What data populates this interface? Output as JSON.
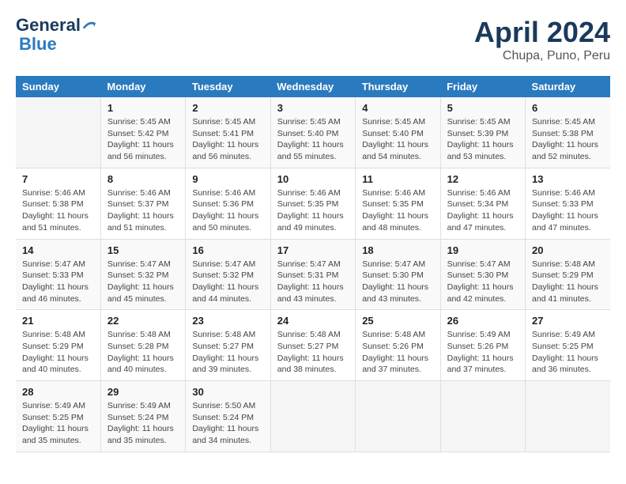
{
  "header": {
    "logo_line1": "General",
    "logo_line2": "Blue",
    "month": "April 2024",
    "location": "Chupa, Puno, Peru"
  },
  "weekdays": [
    "Sunday",
    "Monday",
    "Tuesday",
    "Wednesday",
    "Thursday",
    "Friday",
    "Saturday"
  ],
  "weeks": [
    [
      {
        "day": "",
        "info": ""
      },
      {
        "day": "1",
        "info": "Sunrise: 5:45 AM\nSunset: 5:42 PM\nDaylight: 11 hours\nand 56 minutes."
      },
      {
        "day": "2",
        "info": "Sunrise: 5:45 AM\nSunset: 5:41 PM\nDaylight: 11 hours\nand 56 minutes."
      },
      {
        "day": "3",
        "info": "Sunrise: 5:45 AM\nSunset: 5:40 PM\nDaylight: 11 hours\nand 55 minutes."
      },
      {
        "day": "4",
        "info": "Sunrise: 5:45 AM\nSunset: 5:40 PM\nDaylight: 11 hours\nand 54 minutes."
      },
      {
        "day": "5",
        "info": "Sunrise: 5:45 AM\nSunset: 5:39 PM\nDaylight: 11 hours\nand 53 minutes."
      },
      {
        "day": "6",
        "info": "Sunrise: 5:45 AM\nSunset: 5:38 PM\nDaylight: 11 hours\nand 52 minutes."
      }
    ],
    [
      {
        "day": "7",
        "info": "Sunrise: 5:46 AM\nSunset: 5:38 PM\nDaylight: 11 hours\nand 51 minutes."
      },
      {
        "day": "8",
        "info": "Sunrise: 5:46 AM\nSunset: 5:37 PM\nDaylight: 11 hours\nand 51 minutes."
      },
      {
        "day": "9",
        "info": "Sunrise: 5:46 AM\nSunset: 5:36 PM\nDaylight: 11 hours\nand 50 minutes."
      },
      {
        "day": "10",
        "info": "Sunrise: 5:46 AM\nSunset: 5:35 PM\nDaylight: 11 hours\nand 49 minutes."
      },
      {
        "day": "11",
        "info": "Sunrise: 5:46 AM\nSunset: 5:35 PM\nDaylight: 11 hours\nand 48 minutes."
      },
      {
        "day": "12",
        "info": "Sunrise: 5:46 AM\nSunset: 5:34 PM\nDaylight: 11 hours\nand 47 minutes."
      },
      {
        "day": "13",
        "info": "Sunrise: 5:46 AM\nSunset: 5:33 PM\nDaylight: 11 hours\nand 47 minutes."
      }
    ],
    [
      {
        "day": "14",
        "info": "Sunrise: 5:47 AM\nSunset: 5:33 PM\nDaylight: 11 hours\nand 46 minutes."
      },
      {
        "day": "15",
        "info": "Sunrise: 5:47 AM\nSunset: 5:32 PM\nDaylight: 11 hours\nand 45 minutes."
      },
      {
        "day": "16",
        "info": "Sunrise: 5:47 AM\nSunset: 5:32 PM\nDaylight: 11 hours\nand 44 minutes."
      },
      {
        "day": "17",
        "info": "Sunrise: 5:47 AM\nSunset: 5:31 PM\nDaylight: 11 hours\nand 43 minutes."
      },
      {
        "day": "18",
        "info": "Sunrise: 5:47 AM\nSunset: 5:30 PM\nDaylight: 11 hours\nand 43 minutes."
      },
      {
        "day": "19",
        "info": "Sunrise: 5:47 AM\nSunset: 5:30 PM\nDaylight: 11 hours\nand 42 minutes."
      },
      {
        "day": "20",
        "info": "Sunrise: 5:48 AM\nSunset: 5:29 PM\nDaylight: 11 hours\nand 41 minutes."
      }
    ],
    [
      {
        "day": "21",
        "info": "Sunrise: 5:48 AM\nSunset: 5:29 PM\nDaylight: 11 hours\nand 40 minutes."
      },
      {
        "day": "22",
        "info": "Sunrise: 5:48 AM\nSunset: 5:28 PM\nDaylight: 11 hours\nand 40 minutes."
      },
      {
        "day": "23",
        "info": "Sunrise: 5:48 AM\nSunset: 5:27 PM\nDaylight: 11 hours\nand 39 minutes."
      },
      {
        "day": "24",
        "info": "Sunrise: 5:48 AM\nSunset: 5:27 PM\nDaylight: 11 hours\nand 38 minutes."
      },
      {
        "day": "25",
        "info": "Sunrise: 5:48 AM\nSunset: 5:26 PM\nDaylight: 11 hours\nand 37 minutes."
      },
      {
        "day": "26",
        "info": "Sunrise: 5:49 AM\nSunset: 5:26 PM\nDaylight: 11 hours\nand 37 minutes."
      },
      {
        "day": "27",
        "info": "Sunrise: 5:49 AM\nSunset: 5:25 PM\nDaylight: 11 hours\nand 36 minutes."
      }
    ],
    [
      {
        "day": "28",
        "info": "Sunrise: 5:49 AM\nSunset: 5:25 PM\nDaylight: 11 hours\nand 35 minutes."
      },
      {
        "day": "29",
        "info": "Sunrise: 5:49 AM\nSunset: 5:24 PM\nDaylight: 11 hours\nand 35 minutes."
      },
      {
        "day": "30",
        "info": "Sunrise: 5:50 AM\nSunset: 5:24 PM\nDaylight: 11 hours\nand 34 minutes."
      },
      {
        "day": "",
        "info": ""
      },
      {
        "day": "",
        "info": ""
      },
      {
        "day": "",
        "info": ""
      },
      {
        "day": "",
        "info": ""
      }
    ]
  ]
}
